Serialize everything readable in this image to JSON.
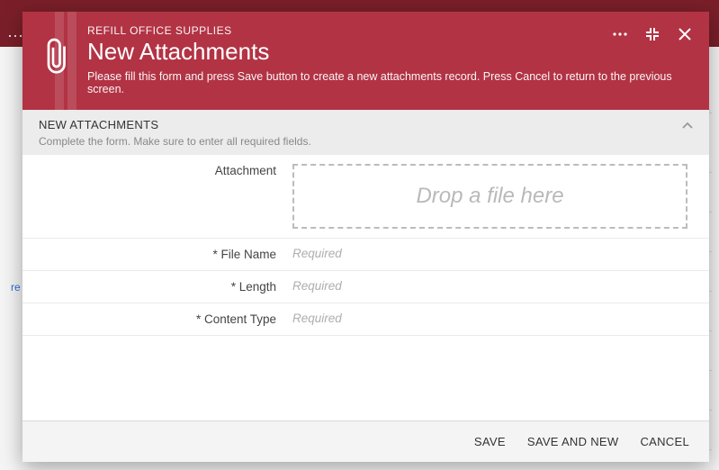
{
  "breadcrumb": "REFILL OFFICE SUPPLIES",
  "title": "New Attachments",
  "description": "Please fill this form and press Save button to create a new attachments record. Press Cancel to return to the previous screen.",
  "section": {
    "title": "NEW ATTACHMENTS",
    "hint": "Complete the form. Make sure to enter all required fields."
  },
  "fields": {
    "attachment_label": "Attachment",
    "dropzone_text": "Drop a file here",
    "filename_label": "* File Name",
    "filename_placeholder": "Required",
    "length_label": "* Length",
    "length_placeholder": "Required",
    "contenttype_label": "* Content Type",
    "contenttype_placeholder": "Required"
  },
  "footer": {
    "save": "SAVE",
    "save_and_new": "SAVE AND NEW",
    "cancel": "CANCEL"
  }
}
